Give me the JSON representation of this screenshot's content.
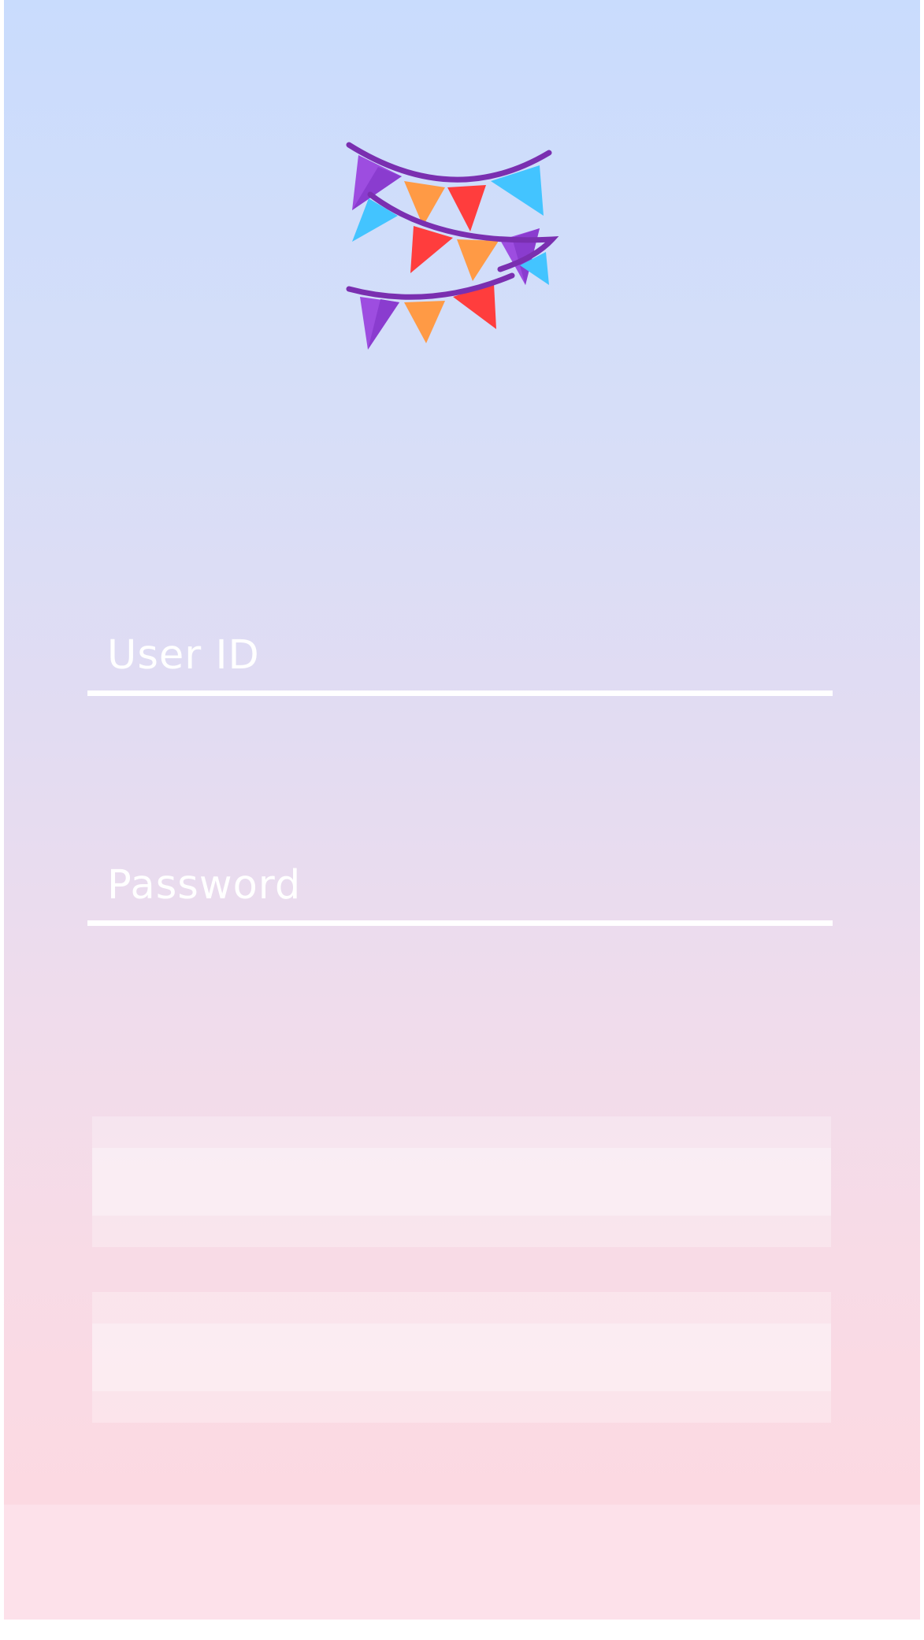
{
  "app": {
    "logo_icon": "party-bunting-icon"
  },
  "login_form": {
    "user_id_placeholder": "User ID",
    "password_placeholder": "Password"
  },
  "actions": {
    "primary_label": "",
    "secondary_label": ""
  },
  "colors": {
    "gradient_top": "#c9dcfd",
    "gradient_bottom": "#fde1ea",
    "field_text": "#ffffff",
    "bunting_purple": "#9d4de0",
    "bunting_orange": "#ff9a45",
    "bunting_red": "#ff3d3d",
    "bunting_blue": "#43c4ff",
    "string_color": "#7a2fb0"
  }
}
